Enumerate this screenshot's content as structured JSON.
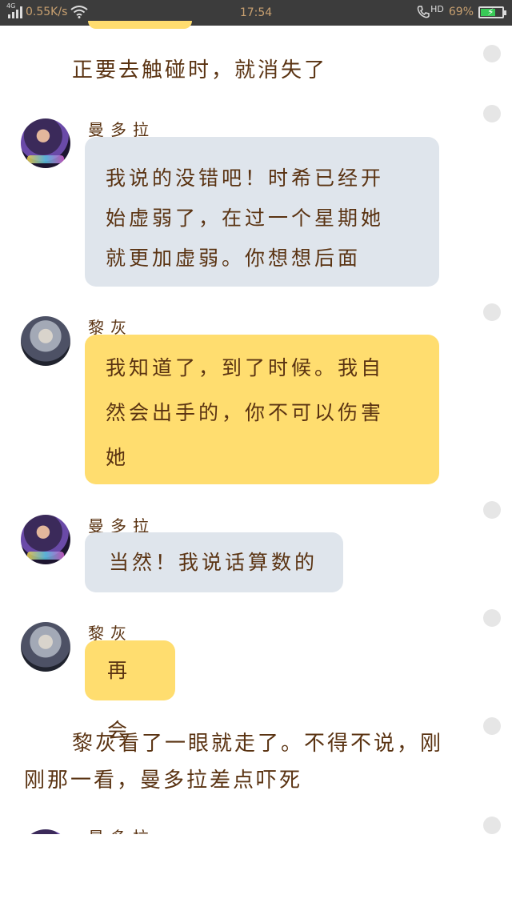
{
  "status_bar": {
    "network_type": "4G",
    "speed": "0.55K/s",
    "time": "17:54",
    "hd_label": "HD",
    "battery": "69%",
    "battery_level": 0.69
  },
  "story": {
    "line1": "正要去触碰时，就消失了",
    "line2a": "黎灰看了一眼就走了。不得不说，刚",
    "line2b": "刚那一看，曼多拉差点吓死"
  },
  "messages": [
    {
      "speaker": "曼多拉",
      "style": "gray",
      "lines": [
        "我说的没错吧！时希已经开",
        "始虚弱了，在过一个星期她",
        "就更加虚弱。你想想后面"
      ]
    },
    {
      "speaker": "黎灰",
      "style": "yellow",
      "lines": [
        "我知道了，到了时候。我自",
        "然会出手的，你不可以伤害",
        "她"
      ]
    },
    {
      "speaker": "曼多拉",
      "style": "gray",
      "lines": [
        "当然！我说话算数的"
      ]
    },
    {
      "speaker": "黎灰",
      "style": "yellow",
      "lines": [
        "再会"
      ]
    },
    {
      "speaker": "曼多拉",
      "style": "gray",
      "lines": []
    }
  ],
  "colors": {
    "status_bg": "#3c3c3c",
    "gray_bubble": "#dfe5ec",
    "yellow_bubble": "#ffdd6f",
    "text_brown": "#5a3312"
  }
}
